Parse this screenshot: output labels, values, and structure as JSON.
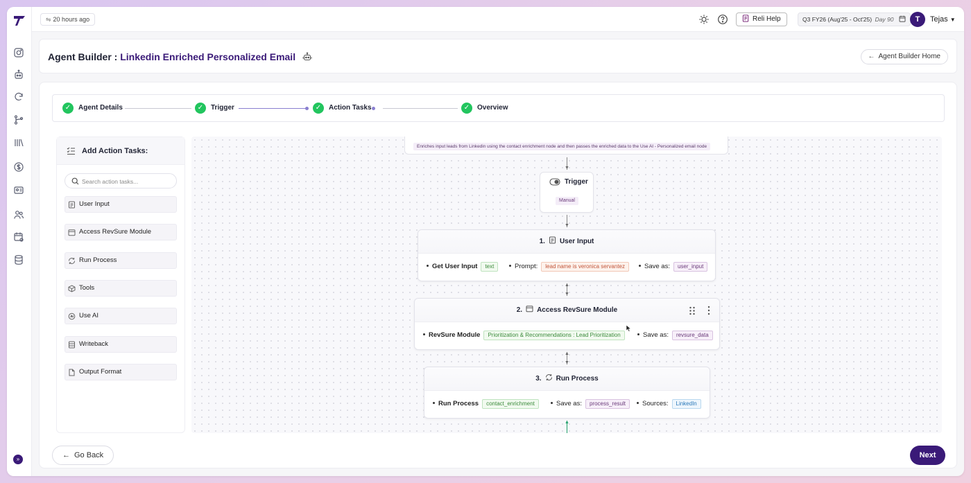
{
  "topbar": {
    "last_updated": "20 hours ago",
    "help_label": "Reli Help",
    "quarter_label": "Q3 FY26 (Aug'25 - Oct'25)",
    "quarter_day": "Day 90",
    "user_initial": "T",
    "user_name": "Tejas"
  },
  "header": {
    "title_prefix": "Agent Builder : ",
    "title_name": "Linkedin Enriched Personalized Email",
    "home_button": "Agent Builder Home"
  },
  "stepper": {
    "steps": [
      {
        "label": "Agent Details",
        "status": "complete"
      },
      {
        "label": "Trigger",
        "status": "complete"
      },
      {
        "label": "Action Tasks",
        "status": "current"
      },
      {
        "label": "Overview",
        "status": "complete"
      }
    ]
  },
  "panel": {
    "title": "Add Action Tasks:",
    "search_placeholder": "Search action tasks...",
    "items": [
      {
        "label": "User Input",
        "icon": "form-icon"
      },
      {
        "label": "Access RevSure Module",
        "icon": "calendar-icon"
      },
      {
        "label": "Run Process",
        "icon": "refresh-icon"
      },
      {
        "label": "Tools",
        "icon": "cube-icon"
      },
      {
        "label": "Use AI",
        "icon": "ai-icon"
      },
      {
        "label": "Writeback",
        "icon": "database-edit-icon"
      },
      {
        "label": "Output Format",
        "icon": "document-icon"
      }
    ]
  },
  "canvas": {
    "description": "Enriches input leads from Linkedin using the contact enrichment node and then passes the enriched data to the Use AI - Personalized email node",
    "trigger": {
      "label": "Trigger",
      "tag": "Manual"
    },
    "nodes": [
      {
        "index": "1.",
        "title": "User Input",
        "fields": [
          {
            "label": "Get User Input",
            "chip": "text"
          },
          {
            "label": "Prompt:",
            "chip": "lead name is veronica servantez"
          },
          {
            "label": "Save as:",
            "chip": "user_input"
          }
        ]
      },
      {
        "index": "2.",
        "title": "Access RevSure Module",
        "fields": [
          {
            "label": "RevSure Module",
            "chip": "Prioritization & Recommendations : Lead Prioritization"
          },
          {
            "label": "Save as:",
            "chip": "revsure_data"
          }
        ]
      },
      {
        "index": "3.",
        "title": "Run Process",
        "fields": [
          {
            "label": "Run Process",
            "chip": "contact_enrichment"
          },
          {
            "label": "Save as:",
            "chip": "process_result"
          },
          {
            "label": "Sources:",
            "chip": "LinkedIn"
          }
        ]
      }
    ]
  },
  "footer": {
    "back_label": "Go Back",
    "next_label": "Next"
  },
  "colors": {
    "brand": "#3a1a78",
    "success": "#22c55e",
    "accent_line": "#8a7fd0"
  }
}
